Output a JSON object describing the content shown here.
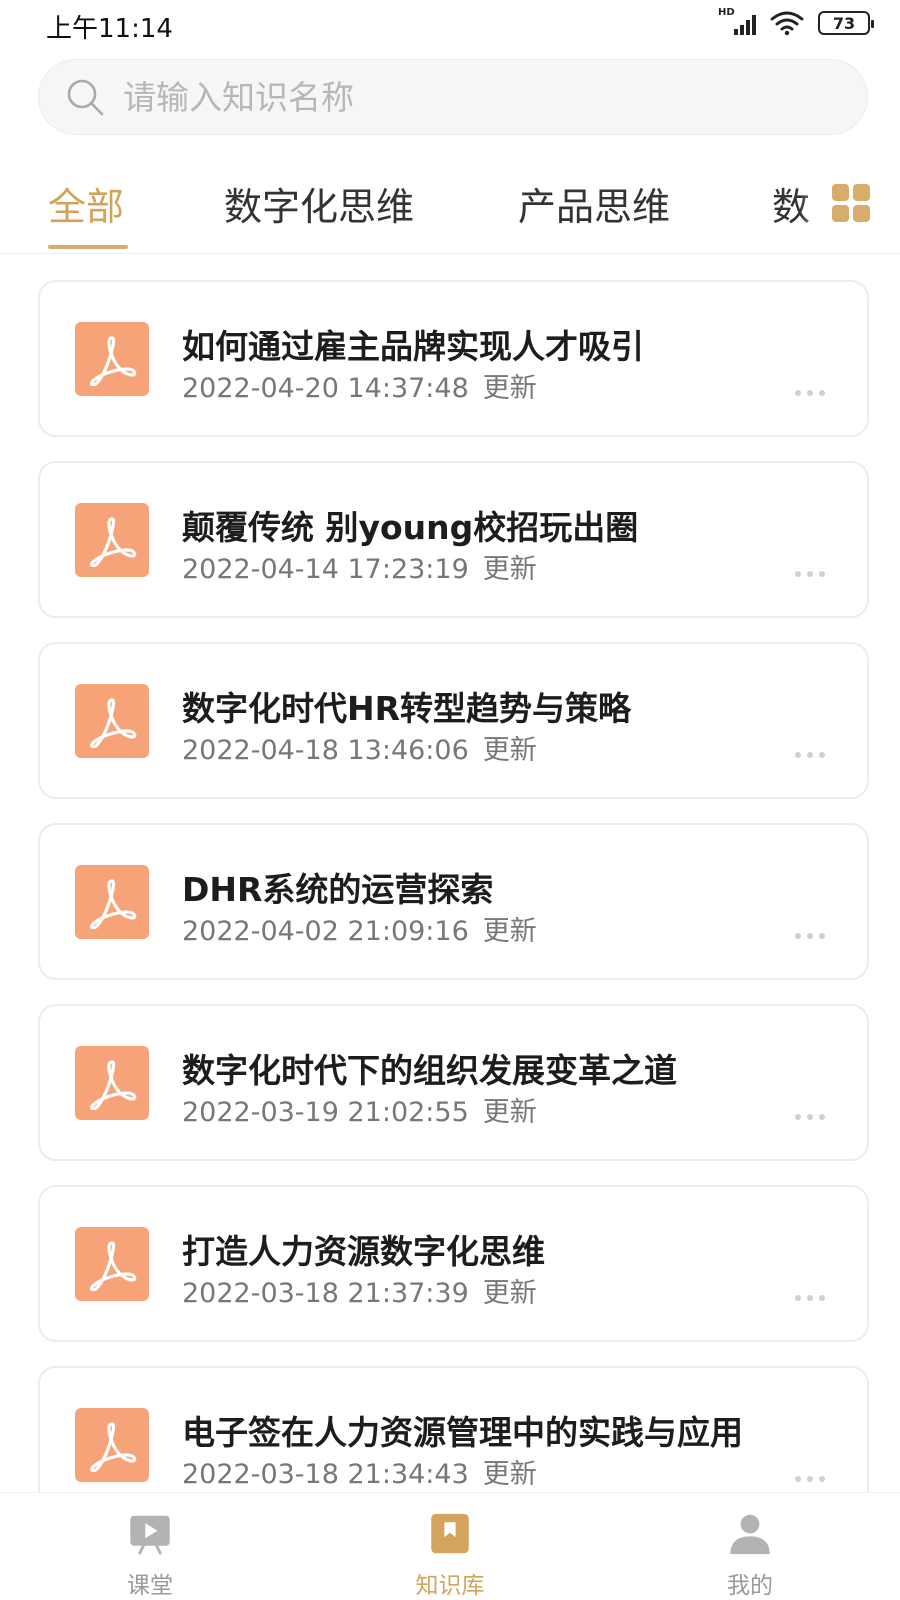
{
  "status_bar": {
    "time": "上午11:14",
    "network_label": "HD",
    "battery": "73"
  },
  "search": {
    "placeholder": "请输入知识名称",
    "value": ""
  },
  "tabs": [
    {
      "label": "全部",
      "active": true
    },
    {
      "label": "数字化思维",
      "active": false
    },
    {
      "label": "产品思维",
      "active": false
    },
    {
      "label": "数",
      "active": false
    }
  ],
  "items": [
    {
      "title": "如何通过雇主品牌实现人才吸引",
      "date": "2022-04-20 14:37:48",
      "status": "更新"
    },
    {
      "title": "颠覆传统 别young校招玩出圈",
      "date": "2022-04-14 17:23:19",
      "status": "更新"
    },
    {
      "title": "数字化时代HR转型趋势与策略",
      "date": "2022-04-18 13:46:06",
      "status": "更新"
    },
    {
      "title": "DHR系统的运营探索",
      "date": "2022-04-02 21:09:16",
      "status": "更新"
    },
    {
      "title": "数字化时代下的组织发展变革之道",
      "date": "2022-03-19 21:02:55",
      "status": "更新"
    },
    {
      "title": "打造人力资源数字化思维",
      "date": "2022-03-18 21:37:39",
      "status": "更新"
    },
    {
      "title": "电子签在人力资源管理中的实践与应用",
      "date": "2022-03-18 21:34:43",
      "status": "更新"
    }
  ],
  "bottom_nav": [
    {
      "label": "课堂",
      "icon": "classroom-icon",
      "active": false
    },
    {
      "label": "知识库",
      "icon": "bookmark-icon",
      "active": true
    },
    {
      "label": "我的",
      "icon": "profile-icon",
      "active": false
    }
  ],
  "colors": {
    "accent": "#d4a35c",
    "file_icon": "#f7a37a",
    "inactive_nav": "#b3b3b3"
  }
}
